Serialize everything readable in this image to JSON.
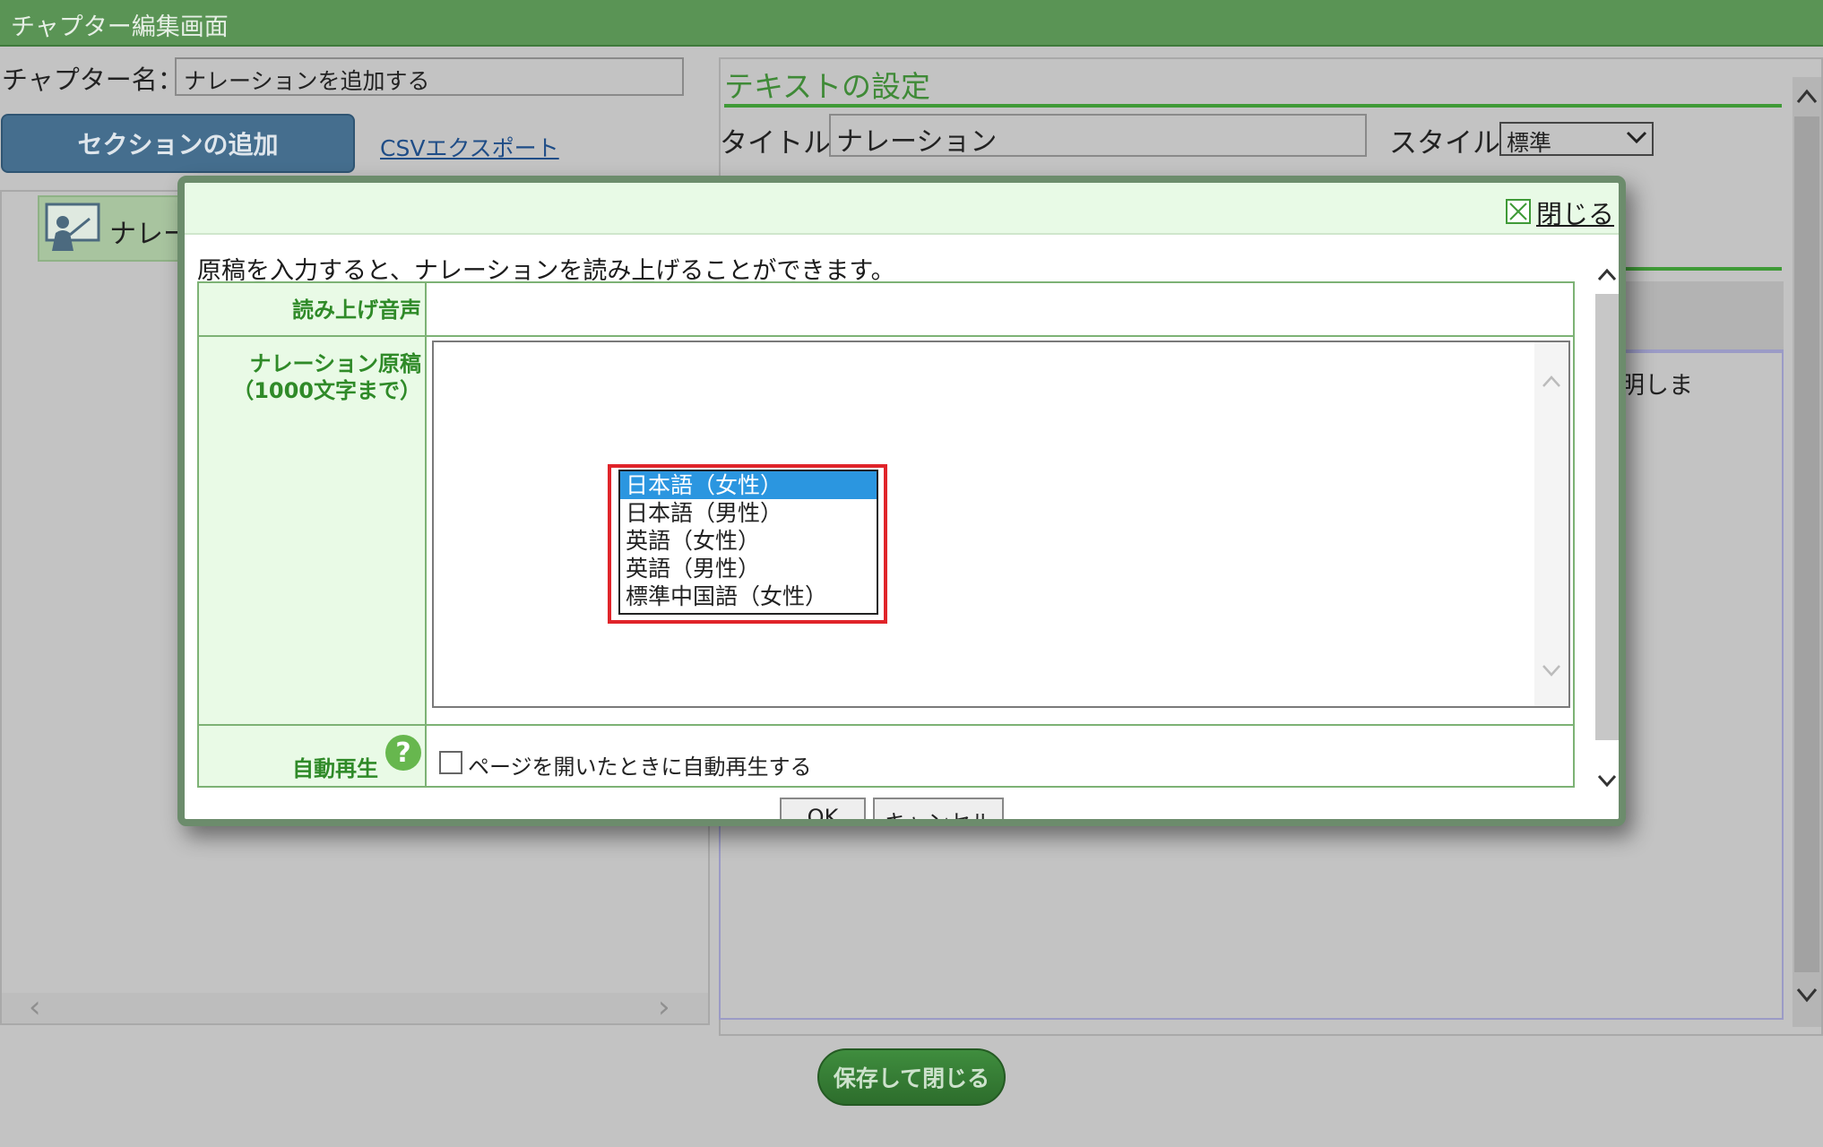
{
  "window": {
    "title": "チャプター編集画面"
  },
  "chapter": {
    "label": "チャプター名：",
    "value": "ナレーションを追加する"
  },
  "toolbar": {
    "add_section_label": "セクションの追加",
    "csv_export_label": "CSVエクスポート"
  },
  "tree": {
    "item_label": "ナレー"
  },
  "text_settings": {
    "heading": "テキストの設定",
    "title_label": "タイトル:",
    "title_value": "ナレーション",
    "style_label": "スタイル:",
    "style_value": "標準",
    "fragment_text": "明しま"
  },
  "footer": {
    "save_close_label": "保存して閉じる"
  },
  "modal": {
    "close_label": "閉じる",
    "description": "原稿を入力すると、ナレーションを読み上げることができます。",
    "voice_label": "読み上げ音声",
    "voice_options": [
      "日本語（女性）",
      "日本語（男性）",
      "英語（女性）",
      "英語（男性）",
      "標準中国語（女性）"
    ],
    "voice_selected_index": 0,
    "script_label_1": "ナレーション原稿",
    "script_label_2": "（1000文字まで）",
    "script_value": "",
    "autoplay_label": "自動再生",
    "autoplay_checkbox_label": "ページを開いたときに自動再生する",
    "autoplay_checked": false,
    "ok_label": "OK",
    "cancel_label": "キャンセル"
  },
  "colors": {
    "header_green": "#5a9455",
    "accent_green": "#3f9a37",
    "highlight_red": "#e0242a",
    "selected_blue": "#2b96e0"
  }
}
